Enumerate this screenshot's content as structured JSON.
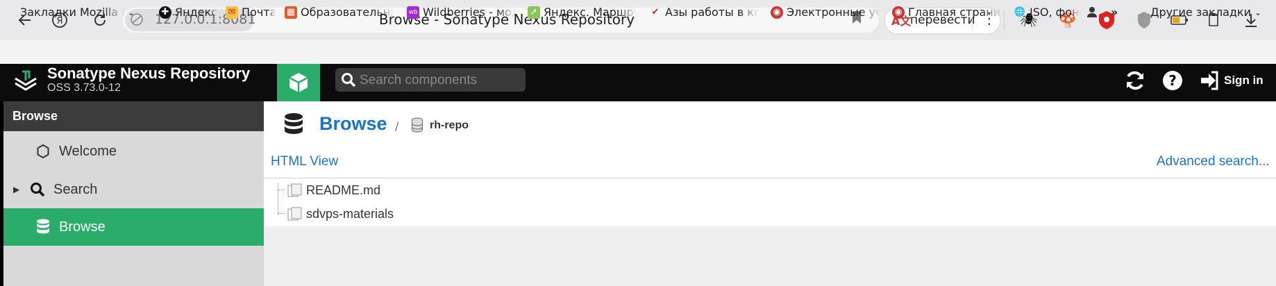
{
  "browser": {
    "url": "127.0.0.1:8081",
    "tab_title": "Browse - Sonatype Nexus Repository",
    "translate_label": "перевести",
    "translate_icon": "A文"
  },
  "bookmarks": [
    {
      "label": "Закладки Mozilla Firefox",
      "icon": "folder-icon"
    },
    {
      "label": "Яндекс",
      "icon": "yandex-icon"
    },
    {
      "label": "Почта",
      "icon": "mail-icon"
    },
    {
      "label": "Образовательные",
      "icon": "edu-icon"
    },
    {
      "label": "Wildberries - модный",
      "icon": "wb-icon"
    },
    {
      "label": "Яндекс. Маршруты",
      "icon": "maps-icon"
    },
    {
      "label": "Азы работы в командной",
      "icon": "check-icon"
    },
    {
      "label": "Электронные услуги",
      "icon": "gov-icon"
    },
    {
      "label": "Главная страница",
      "icon": "gov-icon"
    },
    {
      "label": "ISO, фон",
      "icon": "globe-icon"
    }
  ],
  "bookmarks_more": "»",
  "bookmarks_other": "Другие закладки",
  "nexus": {
    "brand_title": "Sonatype Nexus Repository",
    "brand_version": "OSS 3.73.0-12",
    "search_placeholder": "Search components",
    "signin_label": "Sign in",
    "accent_color": "#2aac6b",
    "link_color": "#1a73c4"
  },
  "sidebar": {
    "title": "Browse",
    "items": [
      {
        "label": "Welcome",
        "icon": "hexagon-icon",
        "selected": false,
        "expandable": false
      },
      {
        "label": "Search",
        "icon": "search-icon",
        "selected": false,
        "expandable": true
      },
      {
        "label": "Browse",
        "icon": "database-icon",
        "selected": true,
        "expandable": false
      }
    ]
  },
  "main": {
    "breadcrumb_title": "Browse",
    "breadcrumb_sep": "/",
    "repo_name": "rh-repo",
    "html_view_link": "HTML View",
    "advanced_search_link": "Advanced search...",
    "tree": [
      {
        "label": "README.md",
        "icon": "file-icon"
      },
      {
        "label": "sdvps-materials",
        "icon": "folder-icon"
      }
    ]
  }
}
